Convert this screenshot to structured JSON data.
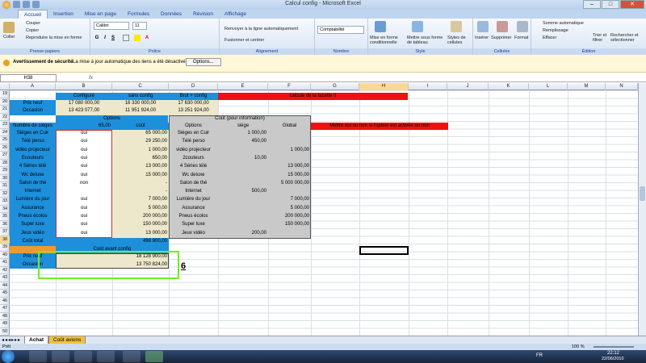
{
  "app": {
    "title": "Calcul config - Microsoft Excel",
    "tabs": [
      "Accueil",
      "Insertion",
      "Mise en page",
      "Formules",
      "Données",
      "Révision",
      "Affichage"
    ],
    "active_tab": "Accueil"
  },
  "ribbon": {
    "clipboard": {
      "paste": "Coller",
      "cut": "Couper",
      "copy": "Copier",
      "format_painter": "Reproduire la mise en forme",
      "label": "Presse-papiers"
    },
    "font": {
      "name": "Calibri",
      "size": "11",
      "label": "Police",
      "bold": "G",
      "italic": "I",
      "underline": "S"
    },
    "alignment": {
      "wrap": "Renvoyer à la ligne automatiquement",
      "merge": "Fusionner et centrer",
      "label": "Alignement"
    },
    "number": {
      "format": "Comptabilité",
      "label": "Nombre"
    },
    "style": {
      "cond": "Mise en forme conditionnelle",
      "table": "Mettre sous forme de tableau",
      "cell_styles": "Styles de cellules",
      "label": "Style"
    },
    "cells": {
      "insert": "Insérer",
      "delete": "Supprimer",
      "format": "Format",
      "label": "Cellules"
    },
    "edit": {
      "autosum": "Somme automatique",
      "fill": "Remplissage",
      "clear": "Effacer",
      "sort": "Trier et filtrer",
      "find": "Rechercher et sélectionner",
      "label": "Édition"
    }
  },
  "security": {
    "title": "Avertissement de sécurité",
    "msg": "La mise à jour automatique des liens a été désactivée",
    "button": "Options..."
  },
  "formula_bar": {
    "name_box": "H38",
    "fx": "fx",
    "content": ""
  },
  "columns": [
    "A",
    "B",
    "C",
    "D",
    "E",
    "F",
    "G",
    "H",
    "I",
    "J",
    "K",
    "L",
    "M",
    "N"
  ],
  "selected_col": "H",
  "rows": [
    "19",
    "20",
    "21",
    "22",
    "23",
    "24",
    "25",
    "26",
    "27",
    "28",
    "29",
    "30",
    "31",
    "32",
    "33",
    "34",
    "35",
    "36",
    "37",
    "38",
    "39",
    "40",
    "41",
    "42",
    "43",
    "44",
    "45",
    "46",
    "47",
    "48",
    "49",
    "50",
    "51",
    "52"
  ],
  "selected_row": "38",
  "cells": {
    "b19": "Configuré",
    "c19": "sans config",
    "d19": "Brut + config",
    "ef19": "calcule de la facette !!",
    "a20": "Prix neuf",
    "b20": "17 080 000,00",
    "c20": "16 330 000,00",
    "d20": "17 630 000,00",
    "a21": "Occasion",
    "b21": "13 423 077,00",
    "c21": "11 951 924,00",
    "d21": "13 251 924,00",
    "b22": "Options",
    "ef22": "Coût (pour information)",
    "a23": "Nombre de sièges",
    "b23": "65,00",
    "c23": "coût",
    "d23": "Options",
    "e23": "siège",
    "f23": "Global",
    "gh23": "Mettre oui ou non si l'option est activée ou non",
    "a24": "Sièges en Cuir",
    "b24": "oui",
    "c24": "65 000,00",
    "d24": "Sièges en Cuir",
    "e24": "1 000,00",
    "a25": "Télé perso",
    "b25": "oui",
    "c25": "29 250,00",
    "d25": "Télé perso",
    "e25": "450,00",
    "a26": "vidéo projecteur",
    "b26": "oui",
    "c26": "1 000,00",
    "d26": "vidéo projecteur",
    "f26": "1 000,00",
    "a27": "Ecouteurs",
    "b27": "oui",
    "c27": "650,00",
    "d27": "2couteurs",
    "e27": "10,00",
    "a28": "4 Séries télé",
    "b28": "oui",
    "c28": "13 000,00",
    "d28": "4 Séries télé",
    "f28": "13 000,00",
    "a29": "Wc deluxe",
    "b29": "oui",
    "c29": "15 000,00",
    "d29": "Wc deluxe",
    "f29": "15 000,00",
    "a30": "Salon de thé",
    "b30": "non",
    "c30": "-",
    "d30": "Salon de thé",
    "f30": "5 000 000,00",
    "a31": "Internet",
    "c31": "-",
    "d31": "Internet",
    "e31": "500,00",
    "a32": "Lumière du jour",
    "b32": "oui",
    "c32": "7 000,00",
    "d32": "Lumière du jour",
    "f32": "7 000,00",
    "a33": "Assurance",
    "b33": "oui",
    "c33": "5 000,00",
    "d33": "Assurance",
    "f33": "5 000,00",
    "a34": "Pneus écolos",
    "b34": "oui",
    "c34": "200 000,00",
    "d34": "Pneus écolos",
    "f34": "200 000,00",
    "a35": "Super luxe",
    "b35": "oui",
    "c35": "150 000,00",
    "d35": "Super luxe",
    "f35": "150 000,00",
    "a36": "Jeux vidéo",
    "b36": "oui",
    "c36": "13 000,00",
    "d36": "Jeux vidéo",
    "e36": "200,00",
    "a37": "Coût total",
    "c37": "498 900,00",
    "bc38": "Coût avant config",
    "a39": "Prix neuf",
    "c39": "18 128 900,00",
    "a40": "Occasion",
    "c40": "13 750 824,00"
  },
  "annotation": "6",
  "sheets": [
    "Achat",
    "Coût avions"
  ],
  "active_sheet": "Achat",
  "status": "Prêt",
  "zoom": "100 %",
  "tray": {
    "lang": "FR",
    "time": "22:12",
    "date": "22/06/2010"
  },
  "colors": {
    "blue": "#1e8fdb",
    "gray": "#c9c9c9",
    "red": "#ee1111",
    "beige": "#ede8cc",
    "green": "#6ef021"
  }
}
